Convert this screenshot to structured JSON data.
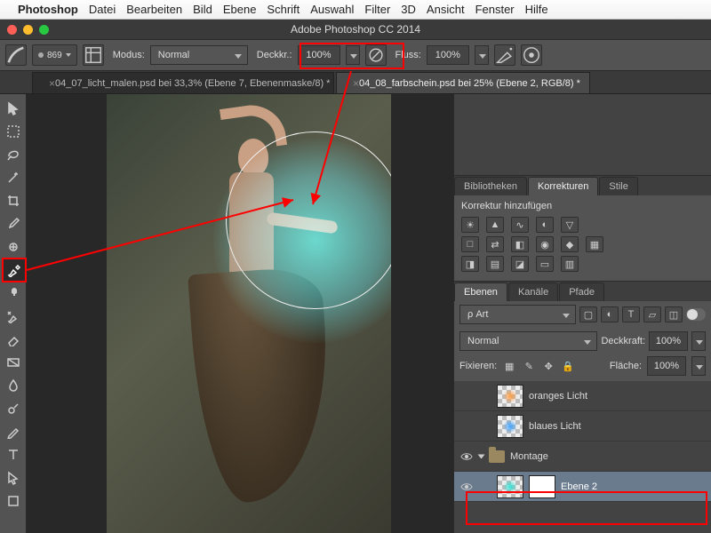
{
  "mac_menu": {
    "app": "Photoshop",
    "items": [
      "Datei",
      "Bearbeiten",
      "Bild",
      "Ebene",
      "Schrift",
      "Auswahl",
      "Filter",
      "3D",
      "Ansicht",
      "Fenster",
      "Hilfe"
    ]
  },
  "app_title": "Adobe Photoshop CC 2014",
  "options_bar": {
    "brush_size": "869",
    "mode_label": "Modus:",
    "mode_value": "Normal",
    "opacity_label": "Deckkr.:",
    "opacity_value": "100%",
    "flow_label": "Fluss:",
    "flow_value": "100%"
  },
  "doc_tabs": [
    {
      "label": "04_07_licht_malen.psd bei 33,3% (Ebene 7, Ebenenmaske/8) *",
      "active": false
    },
    {
      "label": "04_08_farbschein.psd bei 25% (Ebene 2, RGB/8) *",
      "active": true
    }
  ],
  "tools": [
    {
      "name": "move",
      "glyph": "move"
    },
    {
      "name": "marquee",
      "glyph": "marquee"
    },
    {
      "name": "lasso",
      "glyph": "lasso"
    },
    {
      "name": "magic-wand",
      "glyph": "wand"
    },
    {
      "name": "crop",
      "glyph": "crop"
    },
    {
      "name": "eyedropper",
      "glyph": "eyedrop"
    },
    {
      "name": "heal",
      "glyph": "heal"
    },
    {
      "name": "brush",
      "glyph": "brush",
      "selected": true
    },
    {
      "name": "stamp",
      "glyph": "stamp"
    },
    {
      "name": "history-brush",
      "glyph": "hbrush"
    },
    {
      "name": "eraser",
      "glyph": "eraser"
    },
    {
      "name": "gradient",
      "glyph": "gradient"
    },
    {
      "name": "blur",
      "glyph": "blur"
    },
    {
      "name": "dodge",
      "glyph": "dodge"
    },
    {
      "name": "pen",
      "glyph": "pen"
    },
    {
      "name": "type",
      "glyph": "type"
    },
    {
      "name": "path-select",
      "glyph": "path"
    },
    {
      "name": "shape",
      "glyph": "shape"
    }
  ],
  "right_panels": {
    "top_tabs": [
      "Bibliotheken",
      "Korrekturen",
      "Stile"
    ],
    "top_active": "Korrekturen",
    "adjust_add_label": "Korrektur hinzufügen",
    "layer_tabs": [
      "Ebenen",
      "Kanäle",
      "Pfade"
    ],
    "layer_active": "Ebenen",
    "filter_kind": "ρ Art",
    "blend_mode": "Normal",
    "opacity_label": "Deckkraft:",
    "opacity_value": "100%",
    "lock_label": "Fixieren:",
    "fill_label": "Fläche:",
    "fill_value": "100%"
  },
  "layers": [
    {
      "visible": false,
      "name": "oranges Licht",
      "thumb_color": "#ff9a3d",
      "indent": 1
    },
    {
      "visible": false,
      "name": "blaues Licht",
      "thumb_color": "#3da3ff",
      "indent": 1
    },
    {
      "visible": true,
      "name": "Montage",
      "is_group": true,
      "open": true,
      "indent": 0
    },
    {
      "visible": true,
      "name": "Ebene 2",
      "thumb_color": "#2fe1d6",
      "indent": 1,
      "selected": true,
      "has_mask": true
    }
  ]
}
